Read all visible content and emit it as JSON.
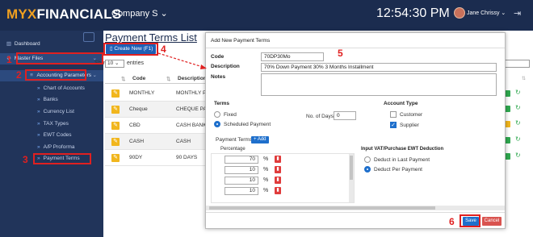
{
  "app": {
    "logo_prefix": "MYX",
    "logo_suffix": "FINANCIALS",
    "company": "Company S",
    "clock": "12:54:30 PM",
    "user": "Jane Chrissy"
  },
  "sidebar": {
    "dashboard": "Dashboard",
    "master_files": "Master Files",
    "accounting_parameters": "Accounting Parameters",
    "items": [
      "Chart of Accounts",
      "Banks",
      "Currency List",
      "TAX Types",
      "EWT Codes",
      "A/P Proforma",
      "Payment Terms"
    ]
  },
  "annotations": [
    "1",
    "2",
    "3",
    "4",
    "5",
    "6"
  ],
  "page": {
    "title": "Payment Terms List",
    "create_button": "Create New (F1)",
    "show_label": "Show",
    "show_value": "10",
    "entries_label": "entries",
    "columns": [
      "Code",
      "Description"
    ],
    "rows": [
      {
        "code": "MONTHLY",
        "desc": "MONTHLY PAYMENT"
      },
      {
        "code": "Cheque",
        "desc": "CHEQUE PAYMENT"
      },
      {
        "code": "CBD",
        "desc": "CASH BANK DEPOSIT"
      },
      {
        "code": "CASH",
        "desc": "CASH"
      },
      {
        "code": "90DY",
        "desc": "90 DAYS"
      }
    ]
  },
  "modal": {
    "title": "Add New Payment Terms",
    "code_label": "Code",
    "code_value": "70DP30Mo",
    "description_label": "Description",
    "description_value": "70% Down Payment 30% 3 Months Installment",
    "notes_label": "Notes",
    "notes_value": "",
    "terms_label": "Terms",
    "fixed_label": "Fixed",
    "scheduled_label": "Scheduled Payment",
    "no_of_days_label": "No. of Days",
    "no_of_days_value": "0",
    "account_type_label": "Account Type",
    "customer_label": "Customer",
    "supplier_label": "Supplier",
    "payment_terms_label": "Payment Terms",
    "add_label": "Add",
    "percentage_label": "Percentage",
    "percentages": [
      "70",
      "10",
      "10",
      "10"
    ],
    "percent_symbol": "%",
    "ewt_label": "Input VAT/Purchase EWT Deduction",
    "deduct_last": "Deduct in Last Payment",
    "deduct_per": "Deduct Per Payment",
    "save": "Save",
    "cancel": "Cancel"
  },
  "colors": {
    "topbar": "#1b2c4f",
    "sidebar": "#21345a",
    "accent": "#1e6fcc",
    "annotation": "#e02020",
    "edit": "#f1b61d",
    "delete": "#e03b3b"
  }
}
